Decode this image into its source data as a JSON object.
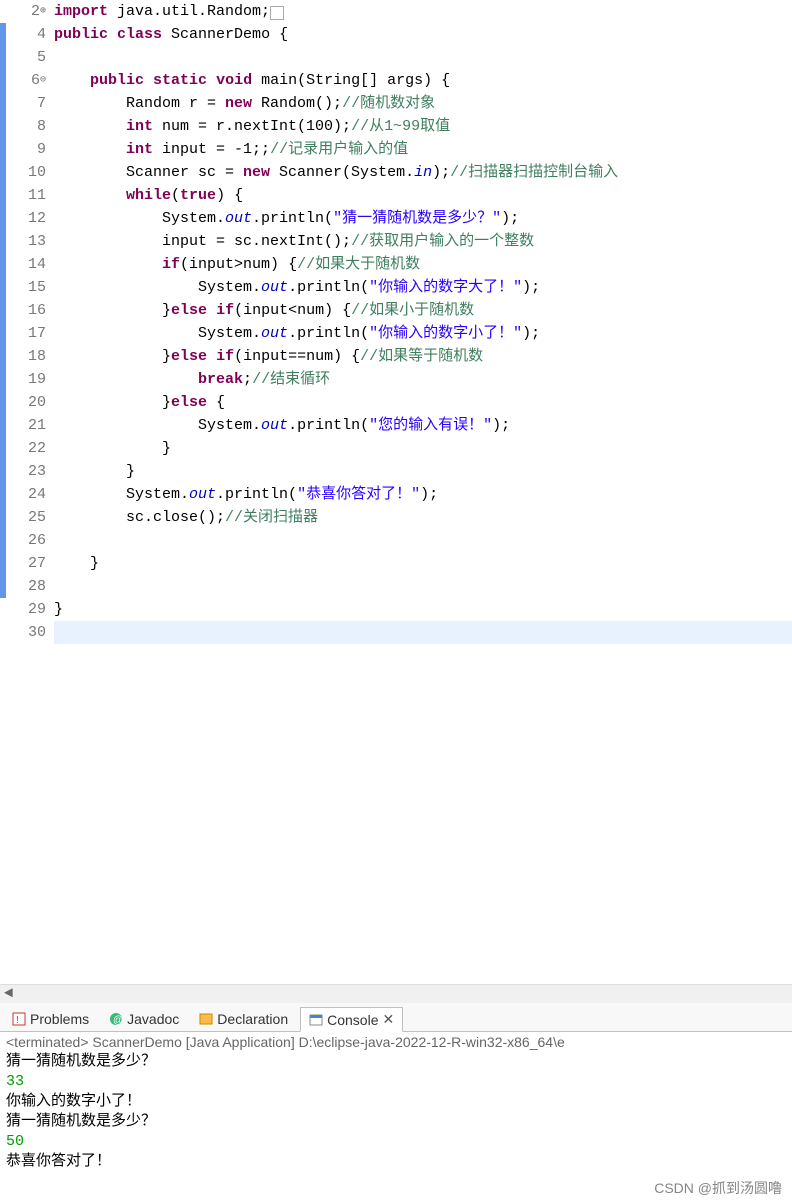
{
  "gutter": {
    "lines": [
      "2",
      "4",
      "5",
      "6",
      "7",
      "8",
      "9",
      "10",
      "11",
      "12",
      "13",
      "14",
      "15",
      "16",
      "17",
      "18",
      "19",
      "20",
      "21",
      "22",
      "23",
      "24",
      "25",
      "26",
      "27",
      "28",
      "29",
      "30"
    ],
    "markers": {
      "0": "⊕",
      "3": "⊖"
    }
  },
  "code": {
    "l2": {
      "kw1": "import",
      "pkg": " java.util.Random;",
      "suffix": ""
    },
    "l4": {
      "kw1": "public",
      "kw2": "class",
      "name": " ScannerDemo {"
    },
    "l6": {
      "kw1": "public",
      "kw2": "static",
      "kw3": "void",
      "name": " main(String[] args) {"
    },
    "l7": {
      "pre": "        Random r = ",
      "kw1": "new",
      "post": " Random();",
      "com": "//随机数对象"
    },
    "l8": {
      "kw1": "int",
      "post": " num = r.nextInt(100);",
      "com": "//从1~99取值"
    },
    "l9": {
      "kw1": "int",
      "post": " input = -1;;",
      "com": "//记录用户输入的值"
    },
    "l10": {
      "pre": "        Scanner sc = ",
      "kw1": "new",
      "post": " Scanner(System.",
      "fld": "in",
      "post2": ");",
      "com": "//扫描器扫描控制台输入"
    },
    "l11": {
      "kw1": "while",
      "post": "(",
      "kw2": "true",
      "post2": ") {"
    },
    "l12": {
      "pre": "            System.",
      "fld": "out",
      "post": ".println(",
      "str": "\"猜一猜随机数是多少？\"",
      "post2": ");"
    },
    "l13": {
      "pre": "            input = sc.nextInt();",
      "com": "//获取用户输入的一个整数"
    },
    "l14": {
      "kw1": "if",
      "post": "(input>num) {",
      "com": "//如果大于随机数"
    },
    "l15": {
      "pre": "                System.",
      "fld": "out",
      "post": ".println(",
      "str": "\"你输入的数字大了！\"",
      "post2": ");"
    },
    "l16": {
      "pre": "            }",
      "kw1": "else",
      "kw2": "if",
      "post": "(input<num) {",
      "com": "//如果小于随机数"
    },
    "l17": {
      "pre": "                System.",
      "fld": "out",
      "post": ".println(",
      "str": "\"你输入的数字小了！\"",
      "post2": ");"
    },
    "l18": {
      "pre": "            }",
      "kw1": "else",
      "kw2": "if",
      "post": "(input==num) {",
      "com": "//如果等于随机数"
    },
    "l19": {
      "kw1": "break",
      "post": ";",
      "com": "//结束循环"
    },
    "l20": {
      "pre": "            }",
      "kw1": "else",
      "post": " {"
    },
    "l21": {
      "pre": "                System.",
      "fld": "out",
      "post": ".println(",
      "str": "\"您的输入有误！\"",
      "post2": ");"
    },
    "l22": {
      "t": "            }"
    },
    "l23": {
      "t": "        }"
    },
    "l24": {
      "pre": "        System.",
      "fld": "out",
      "post": ".println(",
      "str": "\"恭喜你答对了！\"",
      "post2": ");"
    },
    "l25": {
      "pre": "        sc.close();",
      "com": "//关闭扫描器"
    },
    "l27": {
      "t": "    }"
    },
    "l29": {
      "t": "}"
    }
  },
  "tabs": {
    "problems": "Problems",
    "javadoc": "Javadoc",
    "declaration": "Declaration",
    "console": "Console"
  },
  "console": {
    "header": "<terminated> ScannerDemo [Java Application] D:\\eclipse-java-2022-12-R-win32-x86_64\\e",
    "lines": [
      {
        "type": "out",
        "t": "猜一猜随机数是多少？"
      },
      {
        "type": "inp",
        "t": "33"
      },
      {
        "type": "out",
        "t": "你输入的数字小了！"
      },
      {
        "type": "out",
        "t": "猜一猜随机数是多少？"
      },
      {
        "type": "inp",
        "t": "50"
      },
      {
        "type": "out",
        "t": "恭喜你答对了！"
      }
    ]
  },
  "watermark": "CSDN @抓到汤圆噜"
}
